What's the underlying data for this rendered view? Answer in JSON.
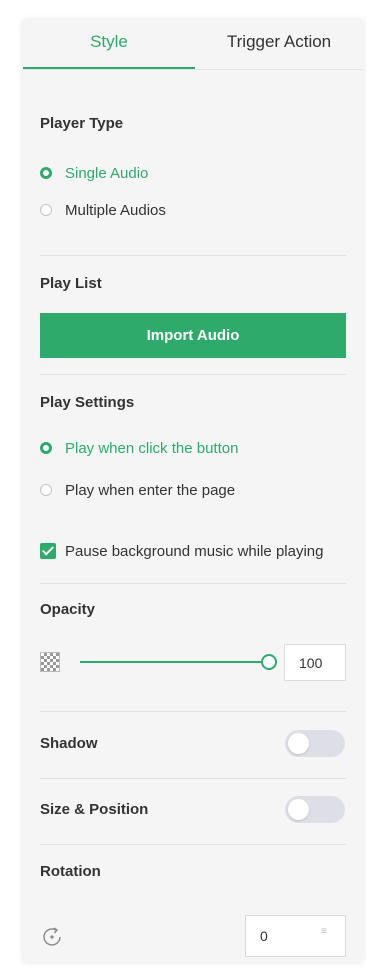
{
  "tabs": {
    "style": "Style",
    "trigger_action": "Trigger Action"
  },
  "player_type": {
    "title": "Player Type",
    "options": [
      "Single Audio",
      "Multiple Audios"
    ],
    "selected": "Single Audio"
  },
  "play_list": {
    "title": "Play List",
    "import_button": "Import Audio"
  },
  "play_settings": {
    "title": "Play Settings",
    "options": [
      "Play when click the button",
      "Play when enter the page"
    ],
    "selected": "Play when click the button",
    "pause_bg_music_label": "Pause background music while playing",
    "pause_bg_music_checked": true
  },
  "opacity": {
    "title": "Opacity",
    "value": "100"
  },
  "shadow": {
    "title": "Shadow",
    "enabled": false
  },
  "size_position": {
    "title": "Size & Position",
    "enabled": false
  },
  "rotation": {
    "title": "Rotation",
    "value": "0"
  },
  "colors": {
    "accent": "#2eaa6a",
    "panel_bg": "#f5f5f5",
    "toggle_off": "#dedee6"
  },
  "icons": {
    "opacity": "checkerboard-icon",
    "rotation": "rotate-icon"
  }
}
